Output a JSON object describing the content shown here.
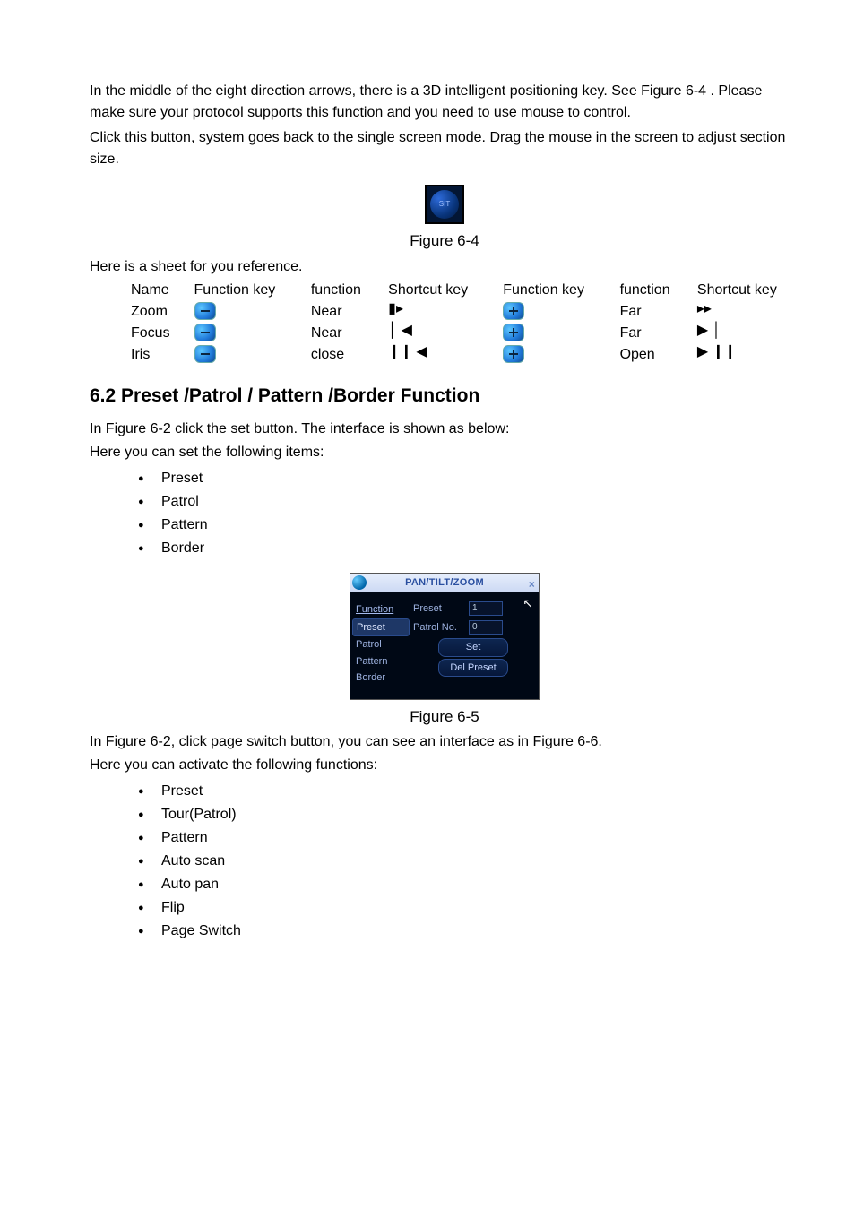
{
  "intro": {
    "p1": "In the middle of the eight direction arrows, there is a 3D intelligent positioning key. See Figure 6-4 . Please make sure your protocol supports this function and you need to use mouse to control.",
    "p2": "Click this button, system goes back to the single screen mode. Drag the mouse in the screen to adjust section size."
  },
  "sit_label": "SIT",
  "figure64_caption": "Figure 6-4",
  "ref_intro": "Here is a sheet for you reference.",
  "ref_header": [
    "Name",
    "Function key",
    "function",
    "Shortcut key",
    "Function key",
    "function",
    "Shortcut key"
  ],
  "ref_rows": [
    {
      "name": "Zoom",
      "fn1": "Near",
      "sc1": "▮▸",
      "fn2": "Far",
      "sc2": "▸▸"
    },
    {
      "name": "Focus",
      "fn1": "Near",
      "sc1": "│ ◀",
      "fn2": "Far",
      "sc2": "▶ │"
    },
    {
      "name": "Iris",
      "fn1": "close",
      "sc1": "❙❙ ◀",
      "fn2": "Open",
      "sc2": "▶ ❙❙"
    }
  ],
  "section62_title": "6.2  Preset  /Patrol / Pattern /Border  Function",
  "sec62_p1": "In Figure 6-2 click the set button. The interface is shown as below:",
  "sec62_p2": "Here you can set the following items:",
  "set_items": [
    "Preset",
    "Patrol",
    "Pattern",
    "Border"
  ],
  "ptz": {
    "title": "PAN/TILT/ZOOM",
    "close": "×",
    "left_header": "Function",
    "left_items": [
      "Preset",
      "Patrol",
      "Pattern",
      "Border"
    ],
    "row_preset_label": "Preset",
    "row_preset_value": "1",
    "row_patrol_label": "Patrol No.",
    "row_patrol_value": "0",
    "btn_set": "Set",
    "btn_del": "Del Preset",
    "cursor": "↖"
  },
  "figure65_caption": "Figure 6-5",
  "sec62_p3": "In Figure 6-2, click page switch button, you can see an interface as in Figure 6-6.",
  "sec62_p4": "Here you can activate the following functions:",
  "activate_items": [
    "Preset",
    "Tour(Patrol)",
    "Pattern",
    "Auto scan",
    "Auto pan",
    "Flip",
    "Page Switch"
  ]
}
